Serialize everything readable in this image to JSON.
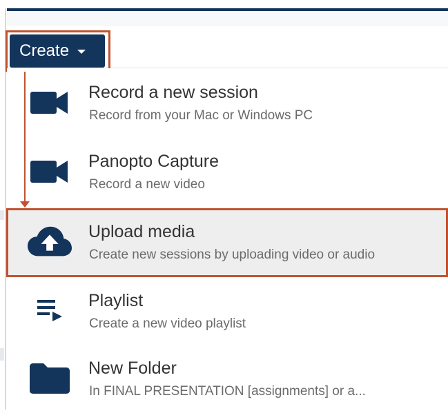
{
  "toolbar": {
    "create_label": "Create"
  },
  "menu": {
    "items": [
      {
        "title": "Record a new session",
        "subtitle": "Record from your Mac or Windows PC",
        "icon": "video-camera-icon"
      },
      {
        "title": "Panopto Capture",
        "subtitle": "Record a new video",
        "icon": "video-camera-icon"
      },
      {
        "title": "Upload media",
        "subtitle": "Create new sessions by uploading video or audio",
        "icon": "cloud-upload-icon",
        "selected": true
      },
      {
        "title": "Playlist",
        "subtitle": "Create a new video playlist",
        "icon": "playlist-icon"
      },
      {
        "title": "New Folder",
        "subtitle": "In FINAL PRESENTATION [assignments] or a...",
        "icon": "folder-icon"
      }
    ]
  },
  "colors": {
    "brand": "#13345b",
    "highlight": "#c0522f",
    "selected_bg": "#eeeeee",
    "title_text": "#333333",
    "subtitle_text": "#6b6b6b"
  }
}
